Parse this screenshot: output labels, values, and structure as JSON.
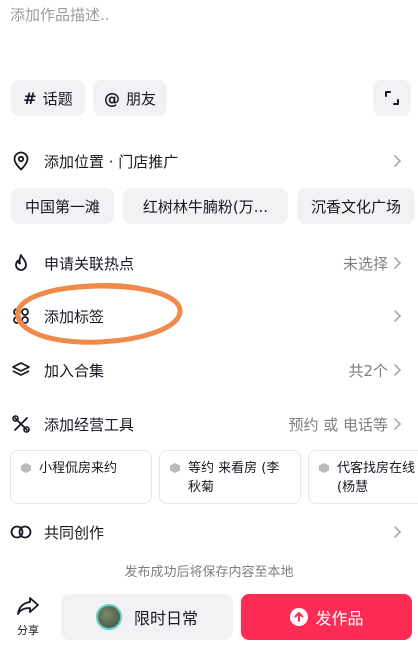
{
  "description_placeholder": "添加作品描述..",
  "chips": {
    "topic_symbol": "#",
    "topic": "话题",
    "friend_symbol": "@",
    "friend": "朋友"
  },
  "location": {
    "label": "添加位置 · 门店推广",
    "suggestions": [
      "中国第一滩",
      "红树林牛腩粉(万...",
      "沉香文化广场"
    ]
  },
  "hot": {
    "label": "申请关联热点",
    "value": "未选择"
  },
  "tag": {
    "label": "添加标签"
  },
  "collection": {
    "label": "加入合集",
    "value": "共2个"
  },
  "tools": {
    "label": "添加经营工具",
    "value": "预约 或 电话等",
    "cards": [
      {
        "line1": "小程侃房来约",
        "line2": ""
      },
      {
        "line1": "等约 来看房 (李",
        "line2": "秋菊"
      },
      {
        "line1": "代客找房在线",
        "line2": "(杨慧"
      }
    ]
  },
  "cocreate": {
    "label": "共同创作"
  },
  "save_note": "发布成功后将保存内容至本地",
  "bottom": {
    "share": "分享",
    "limited": "限时日常",
    "publish": "发作品"
  },
  "colors": {
    "publish": "#fe2c55",
    "annotation": "#f08a4b"
  }
}
